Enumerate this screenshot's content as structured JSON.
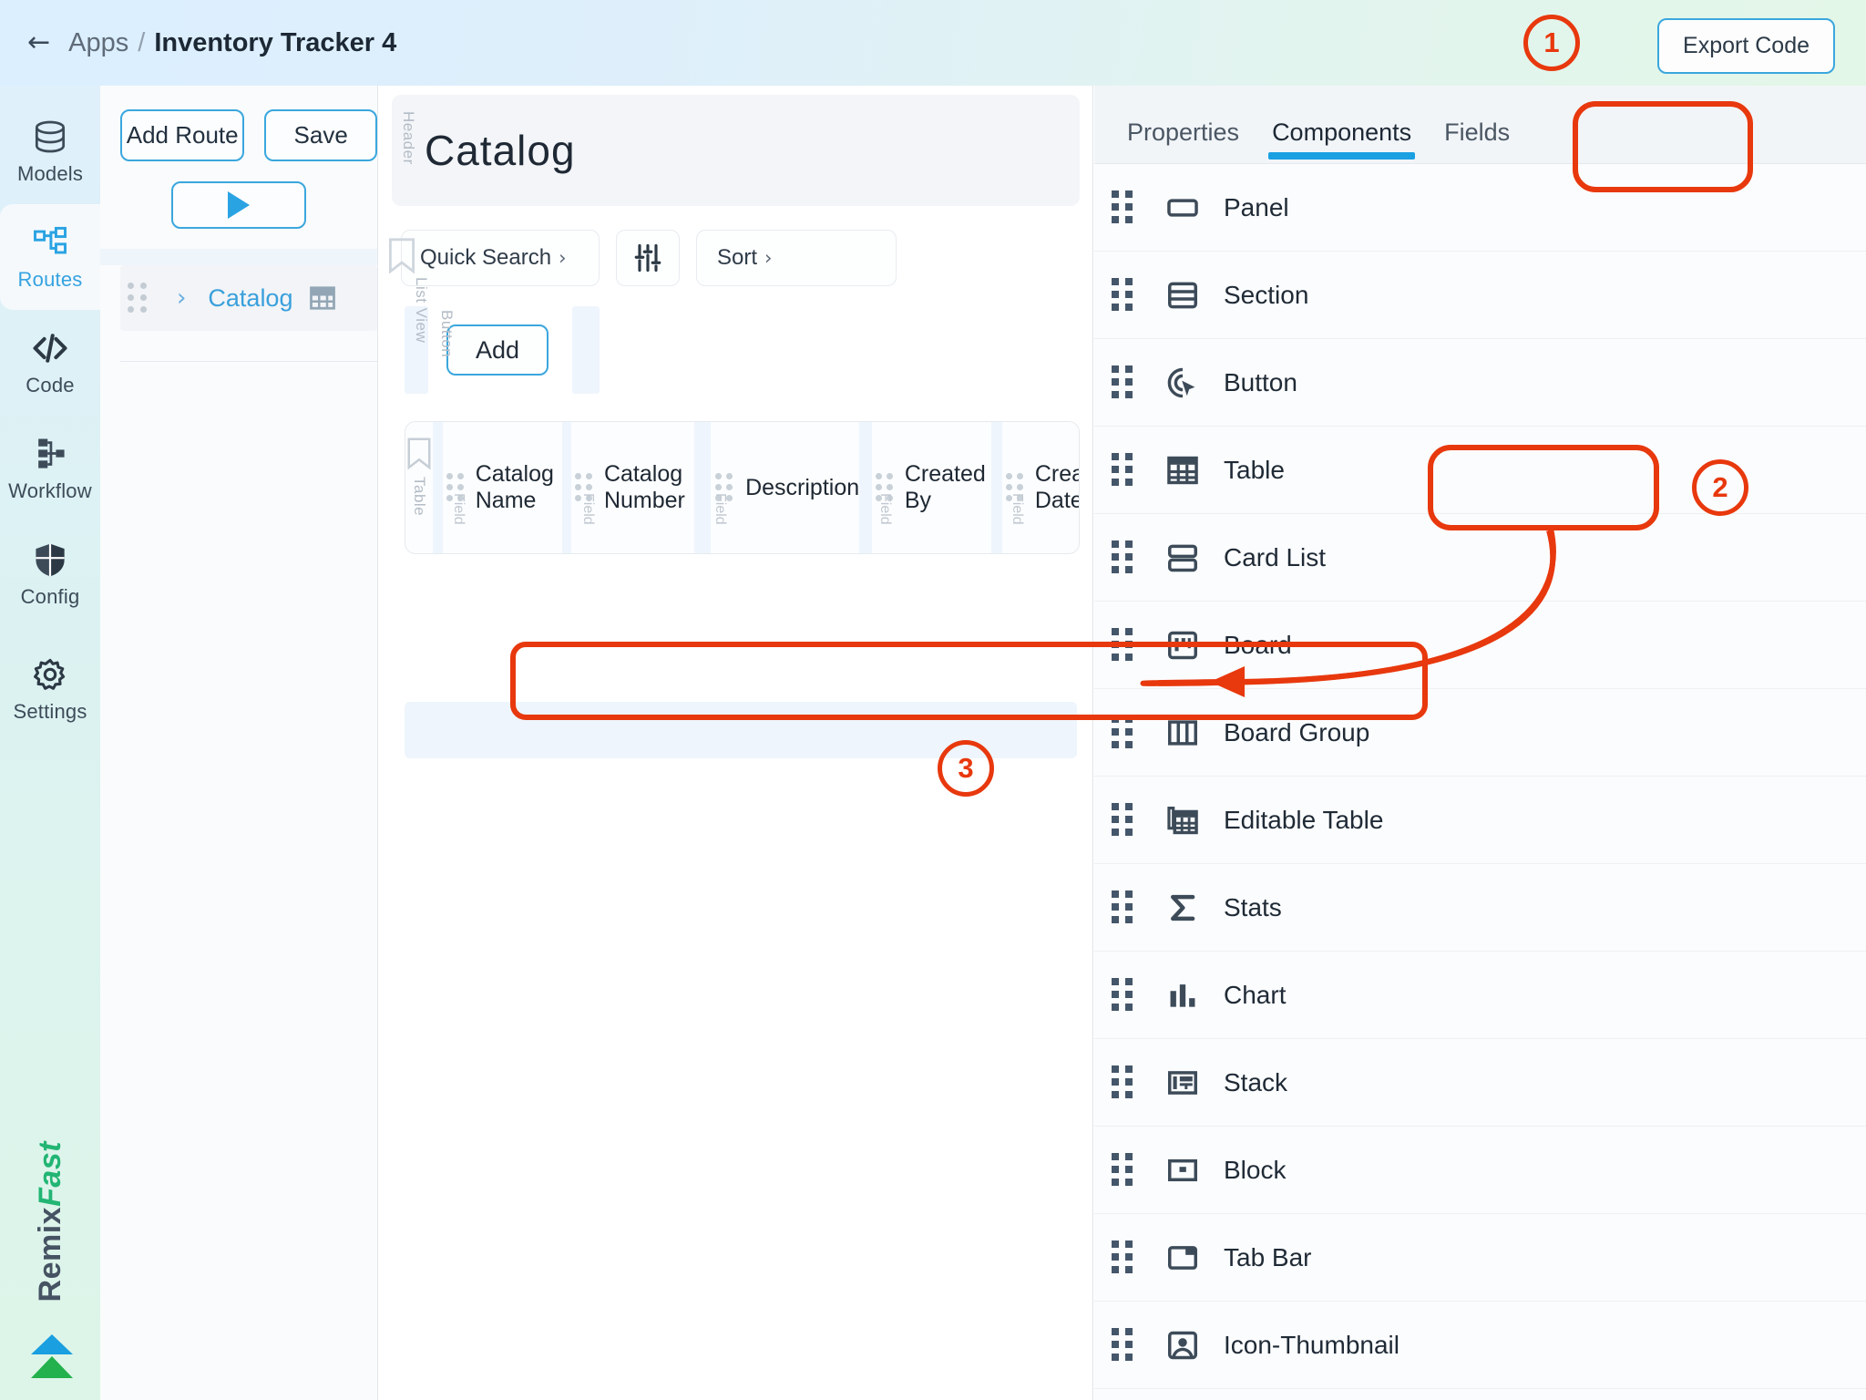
{
  "topbar": {
    "back_icon": "back-arrow-icon",
    "breadcrumb_root": "Apps",
    "breadcrumb_sep": "/",
    "app_title": "Inventory Tracker 4",
    "export_label": "Export Code"
  },
  "rail": {
    "items": [
      {
        "label": "Models",
        "icon": "database-icon",
        "active": false
      },
      {
        "label": "Routes",
        "icon": "routes-nodes-icon",
        "active": true
      },
      {
        "label": "Code",
        "icon": "code-brackets-icon",
        "active": false
      },
      {
        "label": "Workflow",
        "icon": "workflow-tree-icon",
        "active": false
      },
      {
        "label": "Config",
        "icon": "shield-icon",
        "active": false
      },
      {
        "label": "Settings",
        "icon": "gear-icon",
        "active": false
      }
    ],
    "brand_primary": "Remix",
    "brand_accent": "Fast",
    "brand_logo_icon": "double-chevron-up-logo"
  },
  "routes_panel": {
    "add_route_label": "Add Route",
    "save_label": "Save",
    "run_icon": "play-triangle-icon",
    "tree": [
      {
        "name": "Catalog",
        "chevron": "›",
        "icon": "table-grid-icon"
      }
    ]
  },
  "canvas": {
    "header_section_label": "Header",
    "page_title": "Catalog",
    "quick_search_label": "Quick Search",
    "quick_search_caret": "›",
    "filter_icon": "sliders-icon",
    "sort_label": "Sort",
    "sort_caret": "›",
    "bookmark_icon": "bookmark-icon",
    "list_view_label": "List View",
    "button_label": "Button",
    "add_button_label": "Add",
    "table_section_label": "Table",
    "field_label": "Field",
    "table_bookmark_icon": "bookmark-icon",
    "columns": [
      "Catalog Name",
      "Catalog Number",
      "Description",
      "Created By",
      "Created Date"
    ]
  },
  "right_panel": {
    "tabs": [
      {
        "label": "Properties",
        "active": false
      },
      {
        "label": "Components",
        "active": true
      },
      {
        "label": "Fields",
        "active": false
      }
    ],
    "components": [
      {
        "label": "Panel",
        "icon": "panel-rect-icon"
      },
      {
        "label": "Section",
        "icon": "section-rows-icon"
      },
      {
        "label": "Button",
        "icon": "button-cursor-icon"
      },
      {
        "label": "Table",
        "icon": "table-grid-icon"
      },
      {
        "label": "Card List",
        "icon": "card-list-icon"
      },
      {
        "label": "Board",
        "icon": "board-icon"
      },
      {
        "label": "Board Group",
        "icon": "board-group-columns-icon"
      },
      {
        "label": "Editable Table",
        "icon": "editable-table-icon"
      },
      {
        "label": "Stats",
        "icon": "sigma-icon"
      },
      {
        "label": "Chart",
        "icon": "bar-chart-icon"
      },
      {
        "label": "Stack",
        "icon": "stack-layout-icon"
      },
      {
        "label": "Block",
        "icon": "block-rect-icon"
      },
      {
        "label": "Tab Bar",
        "icon": "tab-bar-icon"
      },
      {
        "label": "Icon-Thumbnail",
        "icon": "person-thumbnail-icon"
      }
    ]
  },
  "annotations": {
    "accent_color": "#e8380d",
    "steps": [
      {
        "number": "1",
        "target": "export-code-button"
      },
      {
        "number": "2",
        "target": "component-table"
      },
      {
        "number": "3",
        "target": "canvas-drop-zone"
      }
    ],
    "arrow": "curved-arrow-table-to-dropzone"
  },
  "theme": {
    "accent_blue": "#1ba0e2",
    "link_blue": "#3aa0dc",
    "brand_green": "#22b573",
    "annotation_red": "#e8380d"
  }
}
